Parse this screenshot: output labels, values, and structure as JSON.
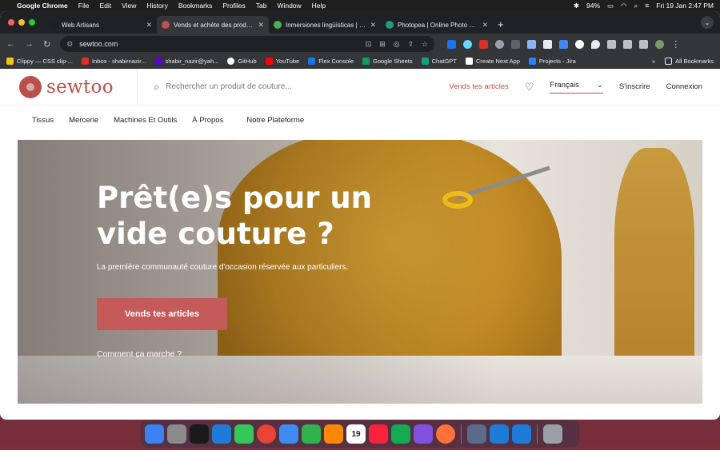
{
  "menubar": {
    "app": "Google Chrome",
    "items": [
      "File",
      "Edit",
      "View",
      "History",
      "Bookmarks",
      "Profiles",
      "Tab",
      "Window",
      "Help"
    ],
    "battery": "94%",
    "datetime": "Fri 19 Jan  2:47 PM"
  },
  "tabs": [
    {
      "title": "Web Artisans",
      "color": "#1f1f1f"
    },
    {
      "title": "Vends et achète des produits",
      "color": "#b9504b"
    },
    {
      "title": "Inmersiones lingüísticas | Ling",
      "color": "#4caf50"
    },
    {
      "title": "Photopea | Online Photo Edit",
      "color": "#1e9e82"
    }
  ],
  "url": "sewtoo.com",
  "bookmarks": [
    {
      "label": "Clippy — CSS clip-...",
      "color": "#f1c40f"
    },
    {
      "label": "Inbox - shabirnazir...",
      "color": "#d93025"
    },
    {
      "label": "shabir_nazir@yah...",
      "color": "#6001d2"
    },
    {
      "label": "GitHub",
      "color": "#ffffff"
    },
    {
      "label": "YouTube",
      "color": "#ff0000"
    },
    {
      "label": "Flex Console",
      "color": "#1a73e8"
    },
    {
      "label": "Google Sheets",
      "color": "#0f9d58"
    },
    {
      "label": "ChatGPT",
      "color": "#10a37f"
    },
    {
      "label": "Create Next App",
      "color": "#ffffff"
    },
    {
      "label": "Projects - Jira",
      "color": "#2684ff"
    }
  ],
  "all_bookmarks": "All Bookmarks",
  "site": {
    "logo": "sewtoo",
    "search_placeholder": "Rechercher un produit de couture...",
    "sell_link": "Vends tes articles",
    "language": "Français",
    "signup": "S'inscrire",
    "login": "Connexion",
    "categories": [
      "Tissus",
      "Mercerie",
      "Machines Et Outils",
      "À Propos",
      "Notre Plateforme"
    ],
    "hero": {
      "title": "Prêt(e)s pour un vide couture ?",
      "subtitle": "La première communauté couture d'occasion réservée aux particuliers.",
      "cta": "Vends tes articles",
      "how": "Comment ça marche ?"
    }
  },
  "colors": {
    "brand": "#b9504b",
    "cta": "#c45a59"
  },
  "dock": [
    {
      "name": "finder",
      "color": "#3b82f6"
    },
    {
      "name": "launchpad",
      "color": "#8b8b8b"
    },
    {
      "name": "terminal",
      "color": "#1a1a1a"
    },
    {
      "name": "vscode",
      "color": "#1e7bd8"
    },
    {
      "name": "messages",
      "color": "#34c759"
    },
    {
      "name": "chrome",
      "color": "#ea4335"
    },
    {
      "name": "mail",
      "color": "#3d8cf0"
    },
    {
      "name": "facetime",
      "color": "#30b24c"
    },
    {
      "name": "vlc",
      "color": "#ff8800"
    },
    {
      "name": "calendar",
      "color": "#ffffff",
      "label": "19"
    },
    {
      "name": "music",
      "color": "#fa233b"
    },
    {
      "name": "mongodb",
      "color": "#13aa52"
    },
    {
      "name": "github-desktop",
      "color": "#8250df"
    },
    {
      "name": "firefox",
      "color": "#ff7139"
    },
    {
      "name": "preview",
      "color": "#5a6b8c"
    },
    {
      "name": "vscode-2",
      "color": "#1e7bd8"
    },
    {
      "name": "vscode-3",
      "color": "#1e7bd8"
    },
    {
      "name": "trash",
      "color": "#9aa0a6"
    }
  ]
}
